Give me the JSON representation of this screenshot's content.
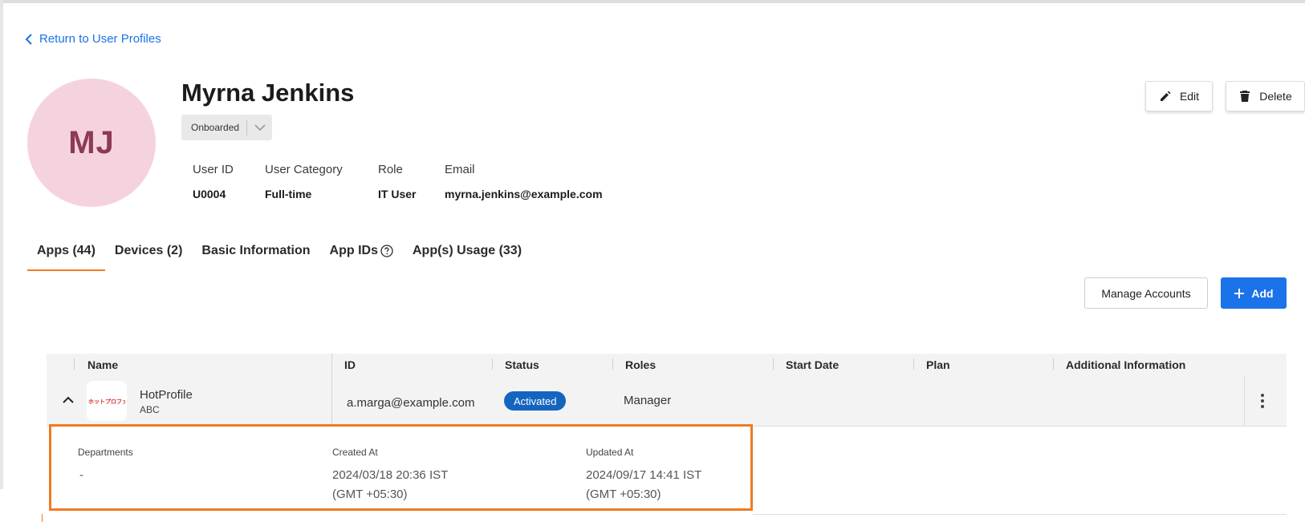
{
  "nav": {
    "back_label": "Return to User Profiles"
  },
  "profile": {
    "initials": "MJ",
    "name": "Myrna Jenkins",
    "status": "Onboarded",
    "fields": [
      {
        "label": "User ID",
        "value": "U0004"
      },
      {
        "label": "User Category",
        "value": "Full-time"
      },
      {
        "label": "Role",
        "value": "IT User"
      },
      {
        "label": "Email",
        "value": "myrna.jenkins@example.com"
      }
    ]
  },
  "actions": {
    "edit_label": "Edit",
    "delete_label": "Delete"
  },
  "tabs": [
    {
      "label": "Apps (44)",
      "active": true
    },
    {
      "label": "Devices (2)"
    },
    {
      "label": "Basic Information"
    },
    {
      "label": "App IDs"
    },
    {
      "label": "App(s) Usage (33)"
    }
  ],
  "toolbar": {
    "manage_label": "Manage Accounts",
    "add_label": "Add"
  },
  "table": {
    "columns": [
      "Name",
      "ID",
      "Status",
      "Roles",
      "Start Date",
      "Plan",
      "Additional Information"
    ],
    "rows": [
      {
        "app_name": "HotProfile",
        "app_sub": "ABC",
        "logo_text": "ホットプロファイル",
        "id": "a.marga@example.com",
        "status": "Activated",
        "roles": "Manager",
        "start_date": "",
        "plan": "",
        "additional_info": ""
      }
    ]
  },
  "details": {
    "departments_label": "Departments",
    "departments_value": "-",
    "created_label": "Created At",
    "created_value": "2024/03/18 20:36 IST",
    "created_tz": "(GMT +05:30)",
    "updated_label": "Updated At",
    "updated_value": "2024/09/17 14:41 IST",
    "updated_tz": "(GMT +05:30)"
  },
  "colors": {
    "accent": "#1a73e8",
    "tab_underline": "#ef7b22",
    "status_badge": "#1565c0",
    "avatar_bg": "#f5d3de",
    "avatar_text": "#8d3a54"
  }
}
